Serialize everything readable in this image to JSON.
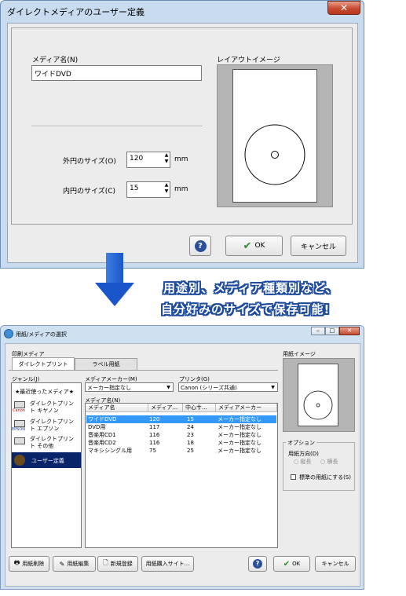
{
  "top_dialog": {
    "title": "ダイレクトメディアのユーザー定義",
    "close_glyph": "✕",
    "media_name_label": "メディア名(N)",
    "media_name_value": "ワイドDVD",
    "layout_image_label": "レイアウトイメージ",
    "outer_size_label": "外円のサイズ(O)",
    "outer_size_value": "120",
    "outer_unit": "mm",
    "inner_size_label": "内円のサイズ(C)",
    "inner_size_value": "15",
    "inner_unit": "mm",
    "help_glyph": "?",
    "ok_label": "OK",
    "cancel_label": "キャンセル"
  },
  "caption": {
    "line1": "用途別、メディア種類別など、",
    "line2": "自分好みのサイズで保存可能!"
  },
  "bottom_dialog": {
    "title": "用紙/メディアの選択",
    "print_media_label": "印刷メディア",
    "tabs": [
      "ダイレクトプリント",
      "ラベル用紙"
    ],
    "genre_label": "ジャンル(J)",
    "genres": [
      {
        "label": "★最近使ったメディア★",
        "brand": ""
      },
      {
        "label": "ダイレクトプリント キヤノン",
        "brand": "Canon"
      },
      {
        "label": "ダイレクトプリント エプソン",
        "brand": "EPSON"
      },
      {
        "label": "ダイレクトプリント その他",
        "brand": ""
      },
      {
        "label": "ユーザー定義",
        "brand": ""
      }
    ],
    "maker_label": "メディアメーカー(M)",
    "maker_value": "メーカー指定なし",
    "printer_label": "プリンタ(G)",
    "printer_value": "Canon (シリーズ共通)",
    "media_name_label": "メディア名(N)",
    "columns": [
      "メディア名",
      "メディア...",
      "中心サ...",
      "メディアメーカー"
    ],
    "rows": [
      [
        "ワイドDVD",
        "120",
        "15",
        "メーカー指定なし"
      ],
      [
        "DVD用",
        "117",
        "24",
        "メーカー指定なし"
      ],
      [
        "音楽用CD1",
        "116",
        "23",
        "メーカー指定なし"
      ],
      [
        "音楽用CD2",
        "116",
        "18",
        "メーカー指定なし"
      ],
      [
        "マキシシングル用",
        "75",
        "25",
        "メーカー指定なし"
      ]
    ],
    "paper_image_label": "用紙イメージ",
    "option_label": "オプション",
    "orientation_label": "用紙方向(D)",
    "portrait_label": "縦長",
    "landscape_label": "横長",
    "standard_paper_label": "標準の用紙にする(S)",
    "buttons": {
      "delete": "用紙削除",
      "edit": "用紙編集",
      "new": "新規登録",
      "buy": "用紙購入サイト...",
      "ok": "OK",
      "cancel": "キャンセル"
    }
  }
}
